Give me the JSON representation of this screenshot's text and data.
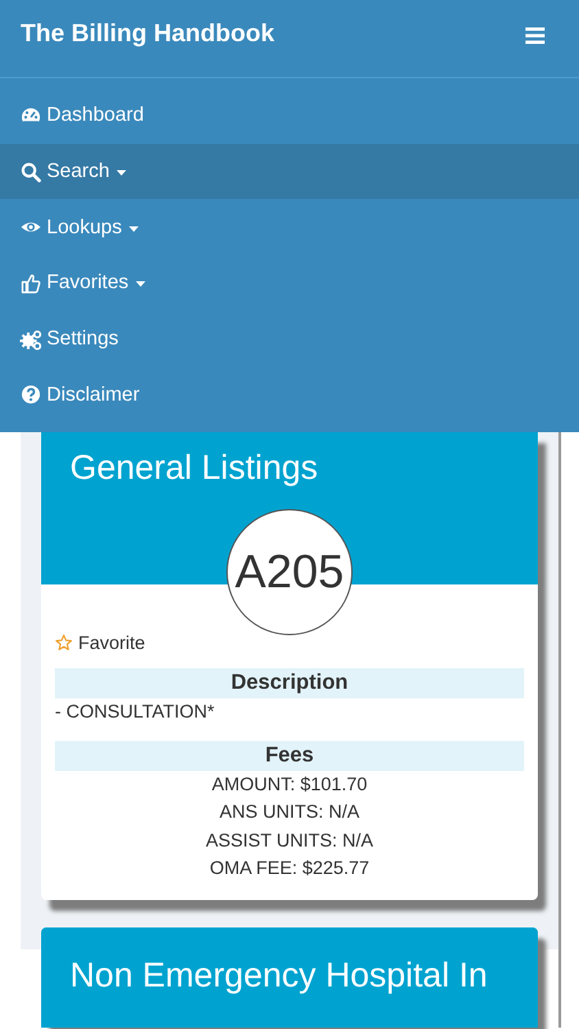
{
  "navbar": {
    "title": "The Billing Handbook"
  },
  "menu": [
    {
      "label": "Dashboard",
      "selected": false,
      "dropdown": false
    },
    {
      "label": "Search",
      "selected": true,
      "dropdown": true
    },
    {
      "label": "Lookups",
      "selected": false,
      "dropdown": true
    },
    {
      "label": "Favorites",
      "selected": false,
      "dropdown": true
    },
    {
      "label": "Settings",
      "selected": false,
      "dropdown": false
    },
    {
      "label": "Disclaimer",
      "selected": false,
      "dropdown": false
    }
  ],
  "cards": [
    {
      "title": "General Listings",
      "code": "A205",
      "favorite_label": "Favorite",
      "favorited": false,
      "sections": [
        {
          "heading": "Description",
          "kind": "paragraph",
          "lines": [
            "- CONSULTATION*"
          ]
        },
        {
          "heading": "Fees",
          "kind": "list",
          "lines": [
            "AMOUNT: $101.70",
            "ANS UNITS: N/A",
            "ASSIST UNITS: N/A",
            "OMA FEE: $225.77"
          ]
        }
      ]
    },
    {
      "title": "Non Emergency Hospital In"
    }
  ]
}
